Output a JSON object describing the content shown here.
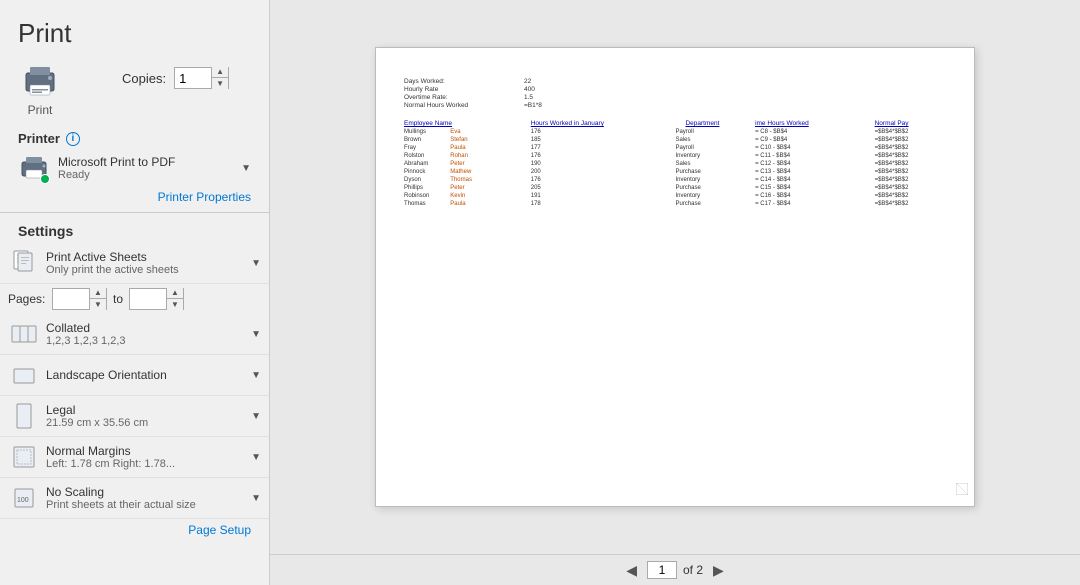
{
  "page": {
    "title": "Print"
  },
  "print_button": {
    "label": "Print"
  },
  "copies": {
    "label": "Copies:",
    "value": "1"
  },
  "printer_section": {
    "label": "Printer",
    "name": "Microsoft Print to PDF",
    "status": "Ready",
    "properties_link": "Printer Properties"
  },
  "settings_section": {
    "label": "Settings"
  },
  "settings": [
    {
      "id": "print-active-sheets",
      "title": "Print Active Sheets",
      "desc": "Only print the active sheets",
      "icon_type": "sheets"
    },
    {
      "id": "collated",
      "title": "Collated",
      "desc": "1,2,3   1,2,3   1,2,3",
      "icon_type": "collate"
    },
    {
      "id": "orientation",
      "title": "Landscape Orientation",
      "desc": "",
      "icon_type": "landscape"
    },
    {
      "id": "paper-size",
      "title": "Legal",
      "desc": "21.59 cm x 35.56 cm",
      "icon_type": "paper"
    },
    {
      "id": "margins",
      "title": "Normal Margins",
      "desc": "Left: 1.78 cm  Right: 1.78...",
      "icon_type": "margins"
    },
    {
      "id": "scaling",
      "title": "No Scaling",
      "desc": "Print sheets at their actual size",
      "icon_type": "scaling"
    }
  ],
  "pages": {
    "label": "Pages:",
    "from": "",
    "to": "",
    "to_label": "to"
  },
  "page_setup_link": "Page Setup",
  "preview": {
    "info_rows": [
      {
        "label": "Days Worked:",
        "value": "22"
      },
      {
        "label": "Hourly Rate",
        "value": "400"
      },
      {
        "label": "Overtime Rate:",
        "value": "1.5"
      },
      {
        "label": "Normal Hours Worked",
        "value": "=B1*8"
      }
    ],
    "table_headers": [
      "Employee Name",
      "",
      "Hours Worked in January",
      "Department",
      "ime Hours Worked",
      "",
      "Normal Pay"
    ],
    "table_rows": [
      [
        "Mullings",
        "Eva",
        "176",
        "Payroll",
        "= C8 - $B$4",
        "",
        "=$B$4*$B$2"
      ],
      [
        "Brown",
        "Stefan",
        "185",
        "Sales",
        "= C9 - $B$4",
        "",
        "=$B$4*$B$2"
      ],
      [
        "Fray",
        "Paula",
        "177",
        "Payroll",
        "= C10 - $B$4",
        "",
        "=$B$4*$B$2"
      ],
      [
        "Rolston",
        "Rohan",
        "176",
        "Inventory",
        "= C11 - $B$4",
        "",
        "=$B$4*$B$2"
      ],
      [
        "Abraham",
        "Peter",
        "190",
        "Sales",
        "= C12 - $B$4",
        "",
        "=$B$4*$B$2"
      ],
      [
        "Pinnock",
        "Mathew",
        "200",
        "Purchase",
        "= C13 - $B$4",
        "",
        "=$B$4*$B$2"
      ],
      [
        "Dyson",
        "Thomas",
        "176",
        "Inventory",
        "= C14 - $B$4",
        "",
        "=$B$4*$B$2"
      ],
      [
        "Phillips",
        "Peter",
        "205",
        "Purchase",
        "= C15 - $B$4",
        "",
        "=$B$4*$B$2"
      ],
      [
        "Robinson",
        "Kevin",
        "191",
        "Inventory",
        "= C16 - $B$4",
        "",
        "=$B$4*$B$2"
      ],
      [
        "Thomas",
        "Paula",
        "178",
        "Purchase",
        "= C17 - $B$4",
        "",
        "=$B$4*$B$2"
      ]
    ]
  },
  "pagination": {
    "current_page": "1",
    "of_label": "of 2"
  }
}
